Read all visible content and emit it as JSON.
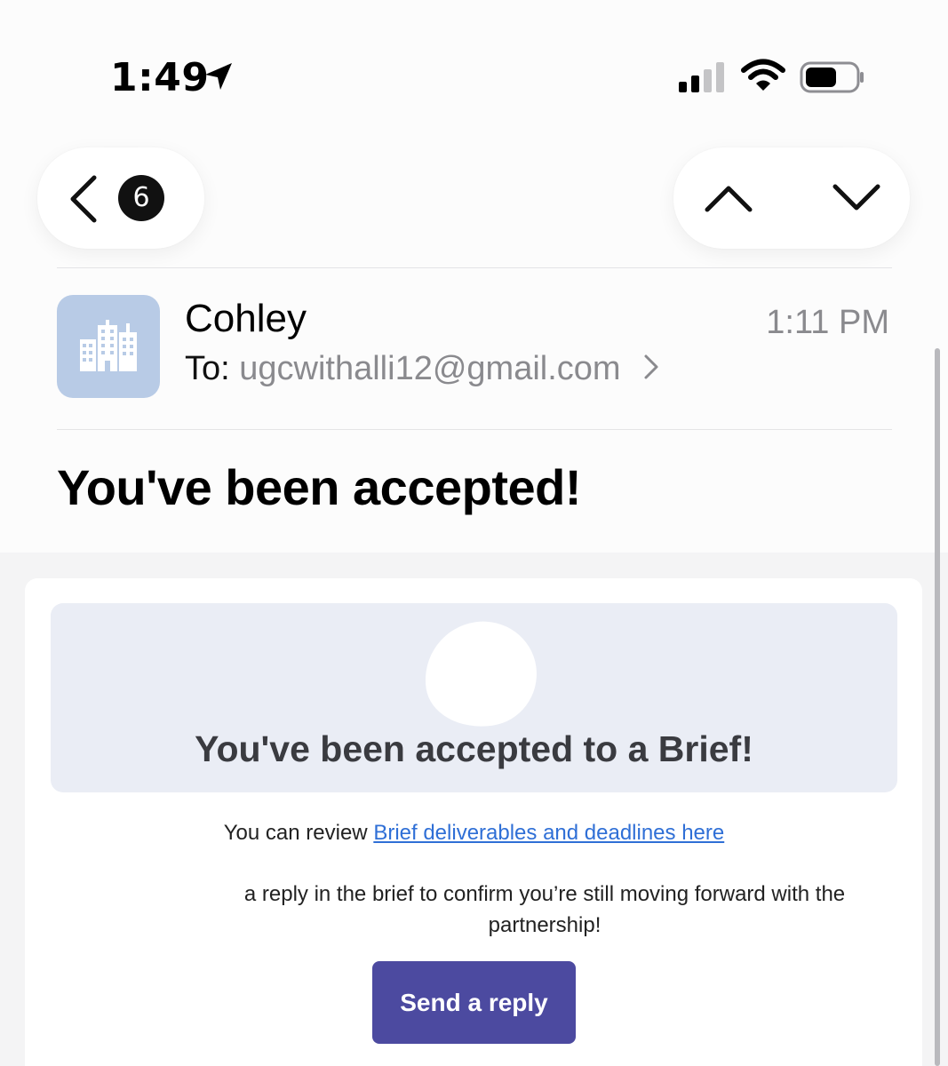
{
  "status_bar": {
    "time": "1:49"
  },
  "nav": {
    "unread_count": "6"
  },
  "message": {
    "sender": "Cohley",
    "to_label": "To:",
    "to_address": "ugcwithalli12@gmail.com",
    "time": "1:11 PM",
    "subject": "You've been accepted!"
  },
  "email_body": {
    "hero_title": "You've been accepted to a Brief!",
    "review_prefix": "You can review ",
    "review_link": "Brief deliverables and deadlines here",
    "reply_text": "a reply in the brief to confirm you’re still moving forward with the partnership!",
    "button_label": "Send a reply"
  },
  "colors": {
    "button": "#4c4aa0",
    "link": "#2f6fd6",
    "avatar_bg": "#b8cbe6",
    "hero_bg": "#eaedf5"
  },
  "icons": {
    "location": "location-arrow-icon",
    "signal": "cellular-signal-icon",
    "wifi": "wifi-icon",
    "battery": "battery-icon",
    "back": "chevron-left-icon",
    "prev": "chevron-up-icon",
    "next": "chevron-down-icon",
    "avatar": "building-icon",
    "recipient_details": "chevron-right-icon"
  }
}
